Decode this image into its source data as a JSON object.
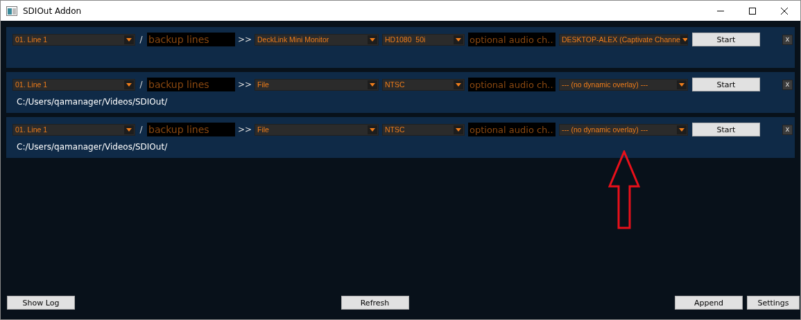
{
  "window": {
    "title": "SDIOut Addon"
  },
  "outputs": [
    {
      "source": "01. Line 1",
      "slash": "/",
      "backup_placeholder": "backup lines",
      "arrow": ">>",
      "device": "DeckLink Mini Monitor",
      "format": "HD1080  50i",
      "audio_placeholder": "optional audio ch...",
      "overlay": "DESKTOP-ALEX (Captivate Channe",
      "start": "Start",
      "remove": "x"
    },
    {
      "source": "01. Line 1",
      "slash": "/",
      "backup_placeholder": "backup lines",
      "arrow": ">>",
      "device": "File",
      "format": "NTSC",
      "audio_placeholder": "optional audio ch...",
      "overlay": "--- (no dynamic overlay) ---",
      "start": "Start",
      "remove": "x",
      "path": "C:/Users/qamanager/Videos/SDIOut/"
    },
    {
      "source": "01. Line 1",
      "slash": "/",
      "backup_placeholder": "backup lines",
      "arrow": ">>",
      "device": "File",
      "format": "NTSC",
      "audio_placeholder": "optional audio ch...",
      "overlay": "--- (no dynamic overlay) ---",
      "start": "Start",
      "remove": "x",
      "path": "C:/Users/qamanager/Videos/SDIOut/"
    }
  ],
  "footer": {
    "show_log": "Show Log",
    "refresh": "Refresh",
    "append": "Append",
    "settings": "Settings"
  }
}
